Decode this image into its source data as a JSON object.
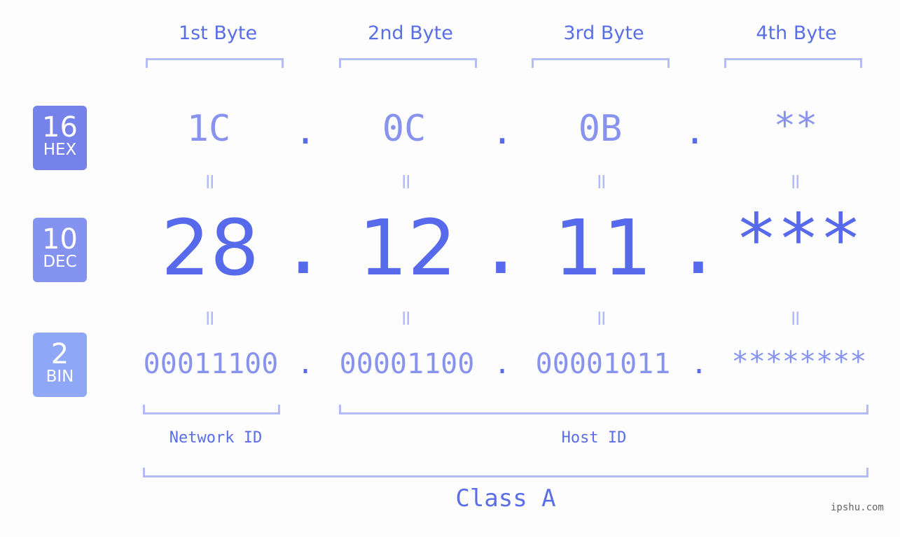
{
  "bytes": {
    "headers": [
      "1st Byte",
      "2nd Byte",
      "3rd Byte",
      "4th Byte"
    ]
  },
  "rows": {
    "hex": {
      "base": "16",
      "name": "HEX",
      "color": "#7482ea",
      "values": [
        "1C",
        "0C",
        "0B",
        "**"
      ]
    },
    "dec": {
      "base": "10",
      "name": "DEC",
      "color": "#8493f0",
      "values": [
        "28",
        "12",
        "11",
        "***"
      ]
    },
    "bin": {
      "base": "2",
      "name": "BIN",
      "color": "#8fa7f7",
      "values": [
        "00011100",
        "00001100",
        "00001011",
        "********"
      ]
    }
  },
  "separator": ".",
  "equals": "=",
  "groups": {
    "network": "Network ID",
    "host": "Host ID",
    "class": "Class A"
  },
  "watermark": "ipshu.com",
  "colors": {
    "accent": "#566aeb",
    "light": "#8793ee",
    "bracket": "#b3bcf6"
  }
}
